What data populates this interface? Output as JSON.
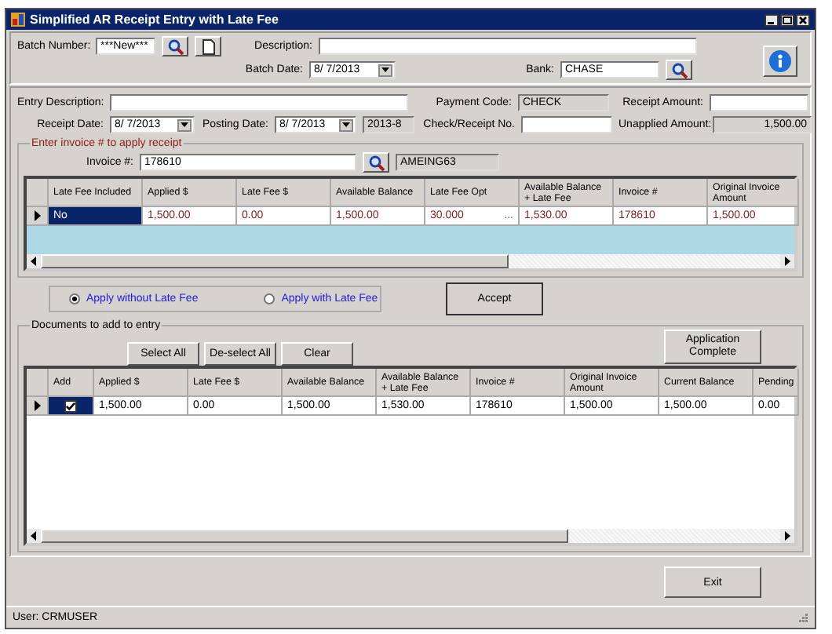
{
  "window": {
    "title": "Simplified AR Receipt Entry with Late Fee"
  },
  "batch": {
    "number": {
      "label": "Batch Number:",
      "value": "***New***"
    },
    "description": {
      "label": "Description:"
    },
    "batch_date": {
      "label": "Batch Date:",
      "value": "8/ 7/2013"
    },
    "bank": {
      "label": "Bank:",
      "value": "CHASE"
    }
  },
  "entry": {
    "description": {
      "label": "Entry Description:"
    },
    "payment_code": {
      "label": "Payment Code:",
      "value": "CHECK"
    },
    "receipt_amount": {
      "label": "Receipt Amount:"
    },
    "receipt_date": {
      "label": "Receipt Date:",
      "value": "8/ 7/2013"
    },
    "posting_date": {
      "label": "Posting Date:",
      "value": "8/ 7/2013"
    },
    "period": "2013-8",
    "check_no": {
      "label": "Check/Receipt No."
    },
    "unapplied_amount": {
      "label": "Unapplied Amount:",
      "value": "1,500.00"
    }
  },
  "invoice_group": {
    "title": "Enter invoice # to apply receipt",
    "invoice": {
      "label": "Invoice #:",
      "value": "178610"
    },
    "customer": "AMEING63",
    "grid": {
      "columns": [
        "Late Fee Included",
        "Applied $",
        "Late Fee $",
        "Available Balance",
        "Late Fee Opt",
        "Available Balance + Late Fee",
        "Invoice #",
        "Original Invoice Amount"
      ],
      "rows": [
        {
          "cells": [
            {
              "kind": "text",
              "text": "No",
              "selected": true
            },
            {
              "kind": "text",
              "text": "1,500.00",
              "selected": false
            },
            {
              "kind": "text",
              "text": "0.00",
              "selected": false
            },
            {
              "kind": "text",
              "text": "1,500.00",
              "selected": false
            },
            {
              "kind": "ellipsis",
              "text": "30.000",
              "button": "...",
              "selected": false
            },
            {
              "kind": "text",
              "text": "1,530.00",
              "selected": false
            },
            {
              "kind": "text",
              "text": "178610",
              "selected": false
            },
            {
              "kind": "text",
              "text": "1,500.00",
              "selected": false
            }
          ]
        }
      ]
    }
  },
  "apply_options": [
    {
      "label": "Apply without Late Fee",
      "selected": true
    },
    {
      "label": "Apply with Late Fee",
      "selected": false
    }
  ],
  "accept_button": "Accept",
  "documents_group": {
    "title": "Documents to add to entry",
    "buttons": [
      "Select All",
      "De-select All",
      "Clear"
    ],
    "complete_button": "Application Complete",
    "grid": {
      "columns": [
        "Add",
        "Applied $",
        "Late Fee $",
        "Available Balance",
        "Available Balance + Late Fee",
        "Invoice #",
        "Original Invoice Amount",
        "Current Balance",
        "Pending"
      ],
      "rows": [
        {
          "cells": [
            {
              "kind": "checkbox",
              "checked": true,
              "selected": true
            },
            {
              "kind": "text",
              "text": "1,500.00",
              "selected": false
            },
            {
              "kind": "text",
              "text": "0.00",
              "selected": false
            },
            {
              "kind": "text",
              "text": "1,500.00",
              "selected": false
            },
            {
              "kind": "text",
              "text": "1,530.00",
              "selected": false
            },
            {
              "kind": "text",
              "text": "178610",
              "selected": false
            },
            {
              "kind": "text",
              "text": "1,500.00",
              "selected": false
            },
            {
              "kind": "text",
              "text": "1,500.00",
              "selected": false
            },
            {
              "kind": "text",
              "text": "0.00",
              "selected": false
            }
          ]
        }
      ]
    }
  },
  "exit_button": "Exit",
  "status_bar": {
    "user": "User: CRMUSER"
  }
}
